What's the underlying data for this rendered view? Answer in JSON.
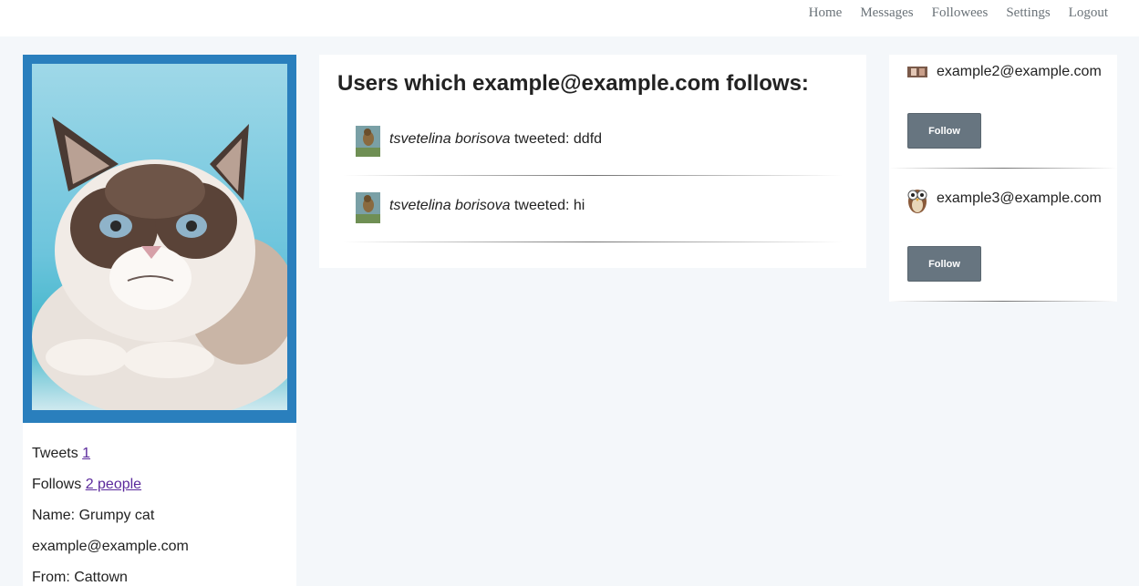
{
  "nav": {
    "items": [
      {
        "label": "Home"
      },
      {
        "label": "Messages"
      },
      {
        "label": "Followees"
      },
      {
        "label": "Settings"
      },
      {
        "label": "Logout"
      }
    ]
  },
  "profile": {
    "tweets_label": "Tweets",
    "tweets_count": "1",
    "follows_label": "Follows",
    "follows_link": "2 people",
    "name": "Name: Grumpy cat",
    "email": "example@example.com",
    "from": "From: Cattown"
  },
  "main": {
    "heading": "Users which example@example.com follows:",
    "tweets": [
      {
        "author": "tsvetelina borisova",
        "verb": " tweeted: ",
        "text": "ddfd"
      },
      {
        "author": "tsvetelina borisova",
        "verb": " tweeted: ",
        "text": "hi"
      }
    ]
  },
  "suggestions": [
    {
      "email": "example2@example.com",
      "button": "Follow"
    },
    {
      "email": "example3@example.com",
      "button": "Follow"
    }
  ],
  "colors": {
    "profile_frame": "#2a7fbd",
    "follow_button": "#677580",
    "link": "#5b2a9c"
  }
}
